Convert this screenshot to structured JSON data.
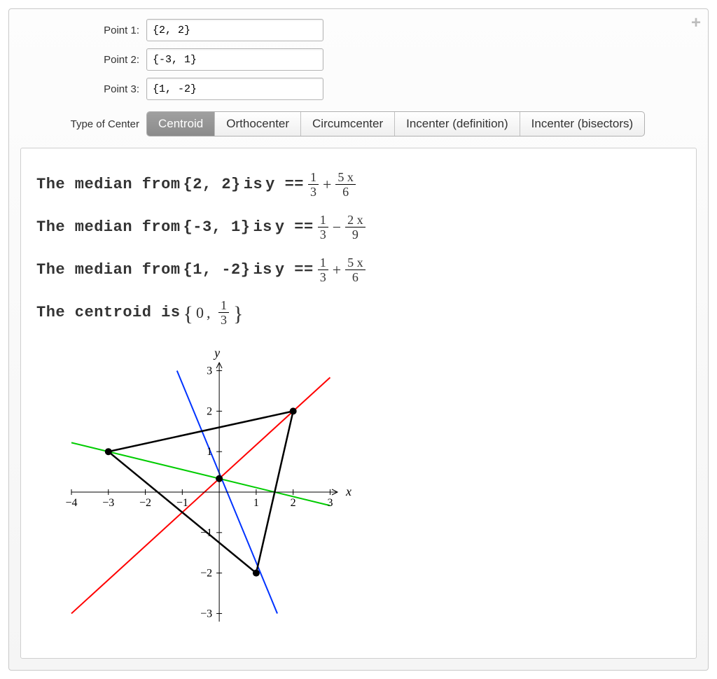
{
  "controls": {
    "point1_label": "Point 1:",
    "point1_value": "{2, 2}",
    "point2_label": "Point 2:",
    "point2_value": "{-3, 1}",
    "point3_label": "Point 3:",
    "point3_value": "{1, -2}",
    "centertype_label": "Type of Center",
    "options": [
      "Centroid",
      "Orthocenter",
      "Circumcenter",
      "Incenter (definition)",
      "Incenter (bisectors)"
    ],
    "selected_index": 0,
    "plus_glyph": "+"
  },
  "output": {
    "lines": [
      {
        "prefix": "The median from ",
        "pt": "{2, 2}",
        "mid": " is ",
        "eq_lhs": "y == ",
        "f1n": "1",
        "f1d": "3",
        "op": " + ",
        "f2n": "5 x",
        "f2d": "6"
      },
      {
        "prefix": "The median from ",
        "pt": "{-3, 1}",
        "mid": " is ",
        "eq_lhs": "y == ",
        "f1n": "1",
        "f1d": "3",
        "op": " − ",
        "f2n": "2 x",
        "f2d": "9"
      },
      {
        "prefix": "The median from ",
        "pt": "{1, -2}",
        "mid": " is ",
        "eq_lhs": "y == ",
        "f1n": "1",
        "f1d": "3",
        "op": " + ",
        "f2n": "5 x",
        "f2d": "6"
      }
    ],
    "centroid_prefix": "The centroid is ",
    "centroid_x": "0",
    "centroid_frac_n": "1",
    "centroid_frac_d": "3"
  },
  "chart_data": {
    "type": "line",
    "xlabel": "x",
    "ylabel": "y",
    "xlim": [
      -4,
      3.2
    ],
    "ylim": [
      -3.2,
      3.2
    ],
    "xticks": [
      -4,
      -3,
      -2,
      -1,
      1,
      2,
      3
    ],
    "yticks": [
      -3,
      -2,
      -1,
      1,
      2,
      3
    ],
    "triangle_vertices": [
      [
        2,
        2
      ],
      [
        -3,
        1
      ],
      [
        1,
        -2
      ]
    ],
    "centroid": [
      0,
      0.3333
    ],
    "series": [
      {
        "name": "median from (2,2)",
        "color": "#ff0000",
        "equation": "y = 1/3 + (5/6) x",
        "endpoints": [
          [
            -4,
            -3
          ],
          [
            3,
            2.833
          ]
        ]
      },
      {
        "name": "median from (-3,1)",
        "color": "#00cc00",
        "equation": "y = 1/3 - (2/9) x",
        "endpoints": [
          [
            -4,
            1.222
          ],
          [
            3,
            -0.333
          ]
        ]
      },
      {
        "name": "median from (1,-2)",
        "color": "#0033ff",
        "equation": "y = 1/3 - (7/3) x",
        "endpoints": [
          [
            -1.143,
            3
          ],
          [
            1.571,
            -3
          ]
        ]
      }
    ]
  }
}
